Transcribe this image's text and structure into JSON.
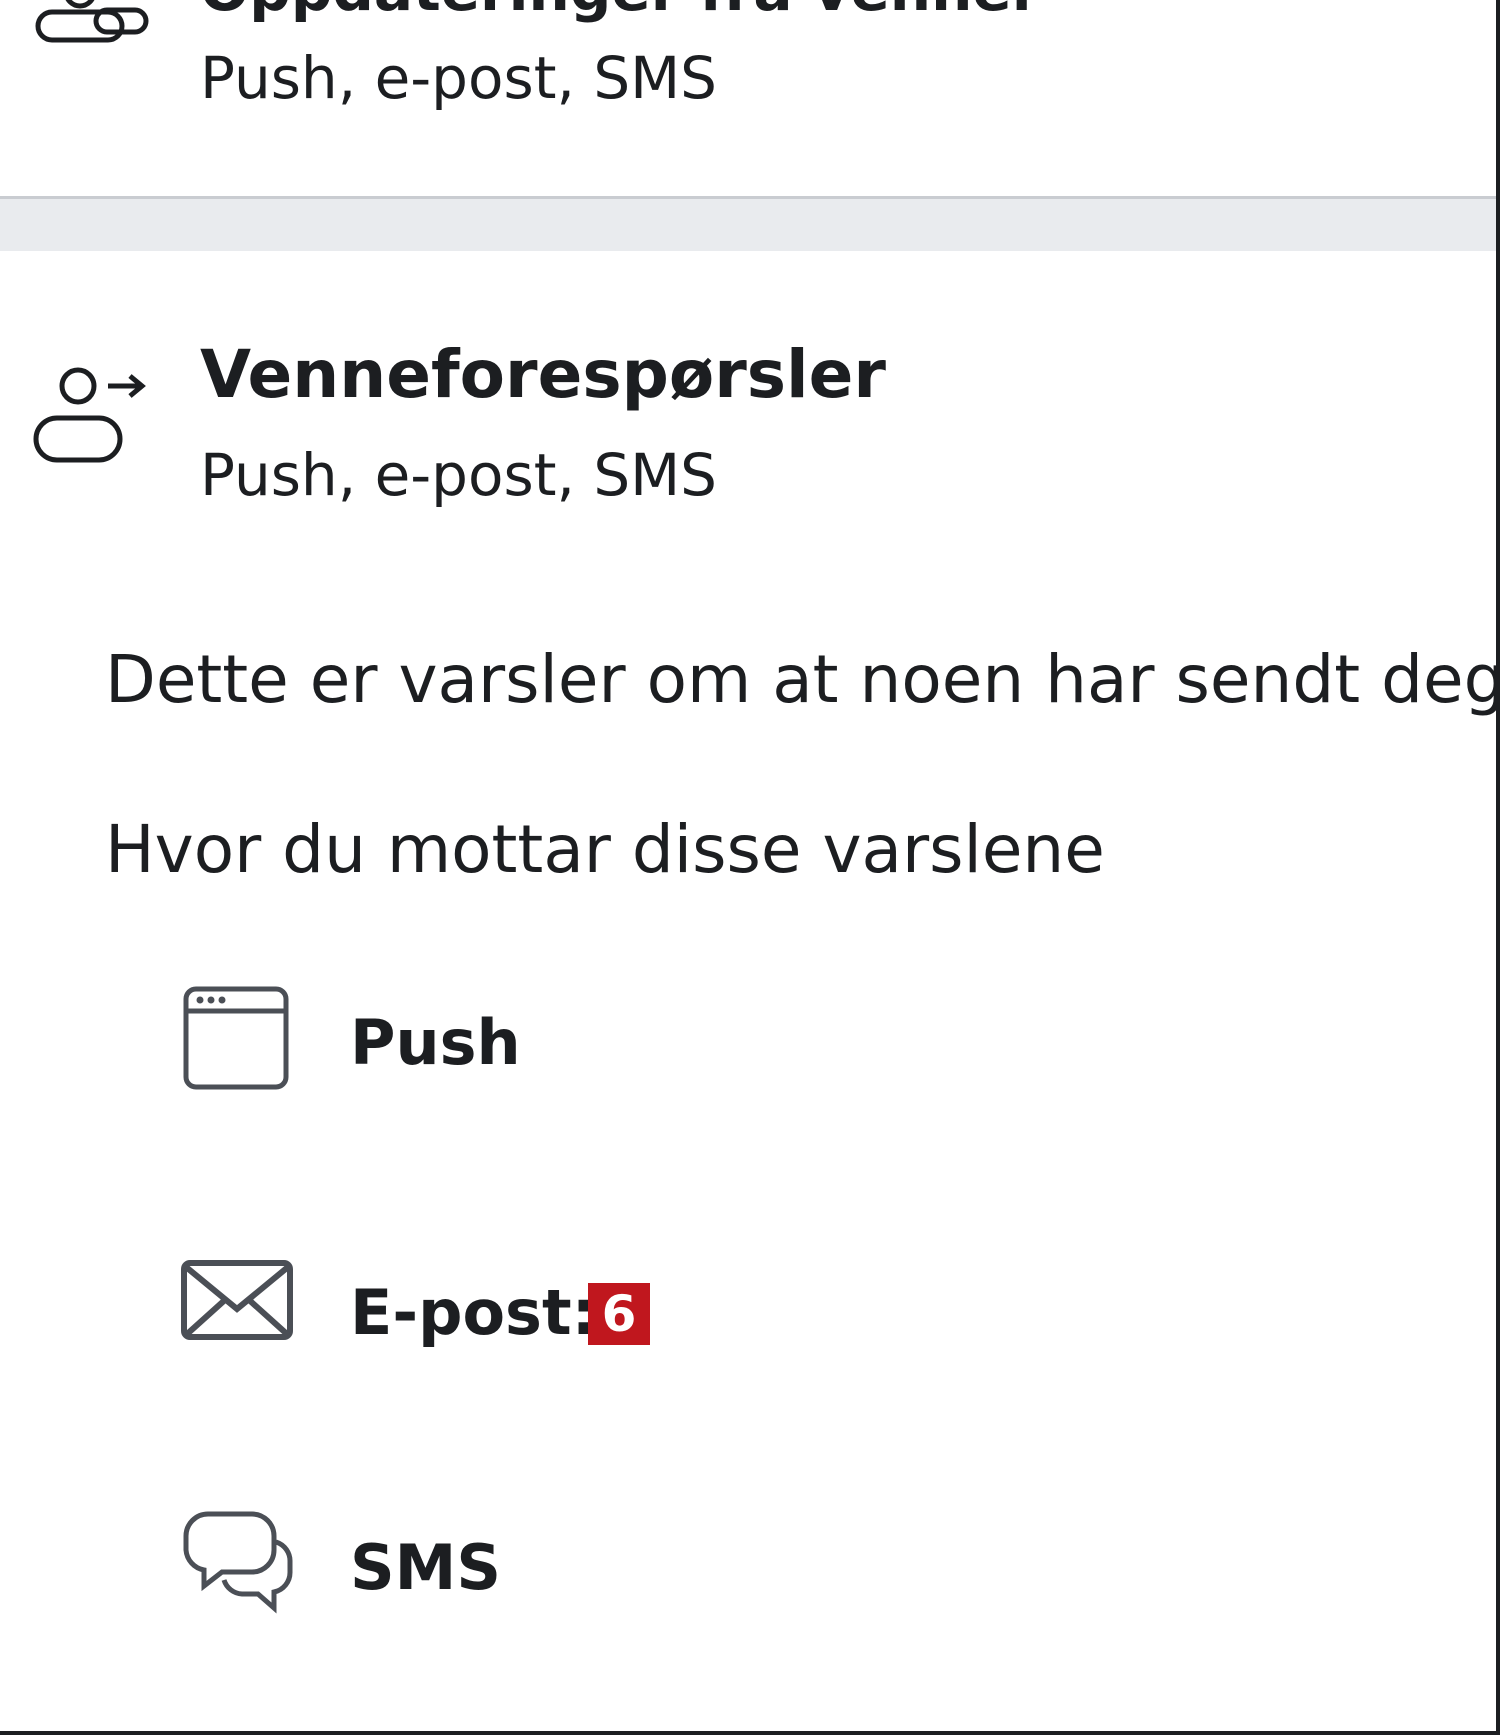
{
  "top_item": {
    "title": "Oppdateringer fra venner",
    "subtitle": "Push, e-post, SMS",
    "icon": "people-icon"
  },
  "friend_requests": {
    "title": "Venneforespørsler",
    "subtitle": "Push, e-post, SMS",
    "icon": "person-arrow-icon"
  },
  "description": "Dette er varsler om at noen har sendt deg en venneforespørsel",
  "section_heading": "Hvor du mottar disse varslene",
  "channels": [
    {
      "label": "Push",
      "icon": "browser-window-icon"
    },
    {
      "label": "E-post:",
      "icon": "envelope-icon",
      "badge": "6"
    },
    {
      "label": "SMS",
      "icon": "chat-bubbles-icon"
    }
  ],
  "colors": {
    "text": "#1c1e21",
    "separator": "#e9ebee",
    "badge": "#c0171e"
  }
}
